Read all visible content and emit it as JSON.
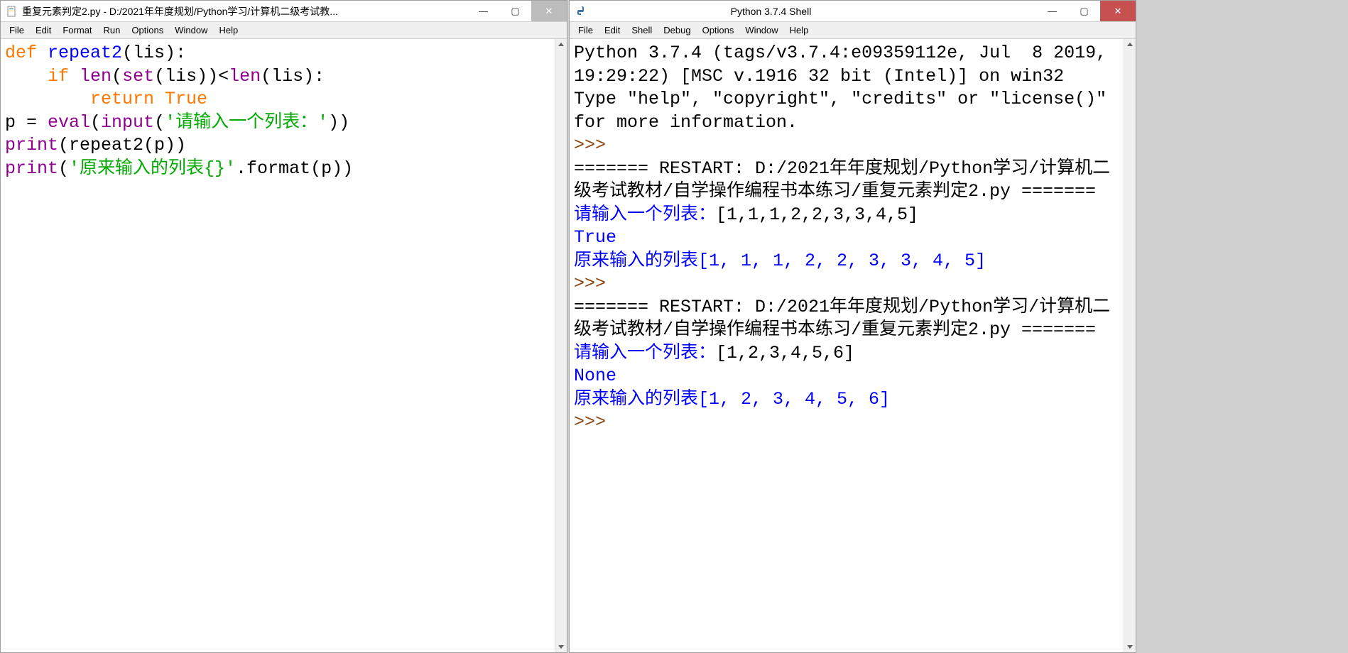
{
  "left": {
    "title": "重复元素判定2.py - D:/2021年年度规划/Python学习/计算机二级考试教...",
    "menu": [
      "File",
      "Edit",
      "Format",
      "Run",
      "Options",
      "Window",
      "Help"
    ],
    "code": {
      "line1": {
        "kw": "def ",
        "name": "repeat2",
        "rest": "(lis):"
      },
      "line2": {
        "indent": "    ",
        "kw": "if ",
        "b1": "len",
        "p1": "(",
        "b2": "set",
        "p2": "(lis))<",
        "b3": "len",
        "p3": "(lis):"
      },
      "line3": {
        "indent": "        ",
        "kw": "return True"
      },
      "line4": {
        "a": "p = ",
        "b1": "eval",
        "p1": "(",
        "b2": "input",
        "p2": "(",
        "s": "'请输入一个列表：'",
        "p3": "))"
      },
      "line5": {
        "b": "print",
        "rest": "(repeat2(p))"
      },
      "line6": {
        "b": "print",
        "p1": "(",
        "s": "'原来输入的列表{}'",
        "rest": ".format(p))"
      }
    }
  },
  "right": {
    "title": "Python 3.7.4 Shell",
    "menu": [
      "File",
      "Edit",
      "Shell",
      "Debug",
      "Options",
      "Window",
      "Help"
    ],
    "shell": {
      "banner1": "Python 3.7.4 (tags/v3.7.4:e09359112e, Jul  8 2019, 19:29:22) [MSC v.1916 32 bit (Intel)] on win32",
      "banner2": "Type \"help\", \"copyright\", \"credits\" or \"license()\" for more information.",
      "prompt": ">>> ",
      "restart1": "======= RESTART: D:/2021年年度规划/Python学习/计算机二级考试教材/自学操作编程书本练习/重复元素判定2.py =======",
      "in1_prompt": "请输入一个列表：",
      "in1_val": "[1,1,1,2,2,3,3,4,5]",
      "out1a": "True",
      "out1b": "原来输入的列表[1, 1, 1, 2, 2, 3, 3, 4, 5]",
      "restart2": "======= RESTART: D:/2021年年度规划/Python学习/计算机二级考试教材/自学操作编程书本练习/重复元素判定2.py =======",
      "in2_prompt": "请输入一个列表：",
      "in2_val": "[1,2,3,4,5,6]",
      "out2a": "None",
      "out2b": "原来输入的列表[1, 2, 3, 4, 5, 6]"
    }
  },
  "winbtn": {
    "min": "—",
    "max": "▢",
    "close": "✕"
  }
}
